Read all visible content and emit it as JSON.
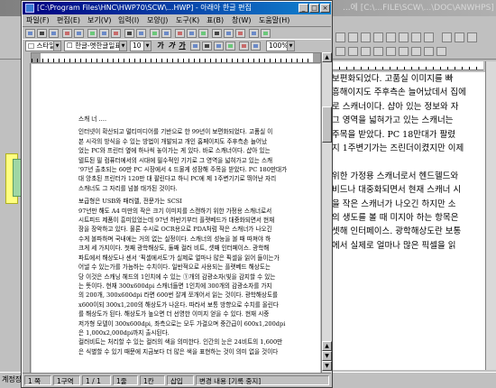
{
  "background_window": {
    "title": "...에 [C:\\...FILE\\SCW\\...\\DOC\\ANWHPS] 문서",
    "document_lines": [
      "보편화되었다. 고품실 이미지를 빠",
      "흥해이지도 주후측손 늘어났데서 집에",
      "로 스캐너이다. 샵아 있는 정보와 자",
      "그 영역을 넓혀가고 있는 스캐너는",
      "주목을 받았다. PC 18만대가 팔렸",
      "지 1주변기가는 즈린더이켰지만 이제",
      "",
      "위한 가정용 스캐너로서 헨드헬드와",
      "비드나 대중화되면서 현재 스캐너 시",
      "을 작은 스캐너가 나오긴 하지만 소",
      "의 생도를 볼 때 미지아 하는 항목은",
      "셋해 인터페이스. 광학해상도란 보통",
      "에서 실제로 얼마나 많은 픽셀을 읽"
    ],
    "status_text": "계정장"
  },
  "window": {
    "title": "[C:\\Program Files\\HNC\\HWP70\\SCW\\...HWP] - 아래아 한글 편집",
    "menu": [
      "파일(F)",
      "편집(E)",
      "보기(V)",
      "입력(I)",
      "모양(J)",
      "도구(K)",
      "표(B)",
      "창(W)",
      "도움말(H)"
    ],
    "style_combo": "□ 스타일",
    "font_combo": "☐ 한글-옛한글일표",
    "size_combo": "10",
    "zoom": "100%",
    "status": {
      "page": "1 쪽",
      "section": "1구역",
      "line": "1 / 1",
      "position": "1줄",
      "col": "1칸",
      "mode": "삽입",
      "extra": "변경 내용 [기록 중지]"
    }
  },
  "document": {
    "heading": "스캐 너 ‥‥",
    "paragraphs": [
      [
        "인터넷이 확산되고 멀티미디어를 기반으로 한 99년이 보편화되었다. 고품실 이",
        "본 시각의 방식을 수 있는 방법이 개발되고 개인 홈페이지도 주후측손 늘어났",
        "었는 PC와 프린터 옆에 하나씩 놓이가는 게 있다. 바로 스캐너이다. 샵아 있는",
        "텔트된 필 컴퓨터에서의 시대에 필수적인 기기로 그 영역을 넓혀가고 있는 스캐",
        "'97년 출초되는 60만 PC 시장에서 4 드물게 성장해 주목을 받았다. PC 180만대가",
        "대 앙초된 프린터가 120만 대 팔린다고 하니 PC에 제 1주변기기로 뛰어난 자리",
        "스캐너도 그 자리를 넘볼 태가된 것이다."
      ],
      [
        "보급형은 USB와 패러렐, 전문가는 SCSI",
        "97년만 해도 A4 미만의 작은 크기 이미지를 스캔하기 위한 가정용 스캐너로서",
        "시트피드 제품이 흥미있었는데 97년 하반기부터 플랫베드가 대중화되면서 현재",
        "장을 장악하고 있다. 물론 수시로 OCR용으로 PDA처럼 작은 스캐너가 나오긴",
        "수게 볼파하며 국내에는 거의 없는 실정이다. 스캐너의 성능을 볼 때 따져야 하",
        "크게 세 가지이다. 첫째 광학해상도, 둘째 컬러 비트, 셋째 인터페이스. 광학해",
        "파트에서 해상도나 센서 '픽셀에서도'가 실제로 얼마나 많은 픽셀을 읽어 들이는가",
        "어낼 수 있는가를 가늠하는 수치이다. 일반적으로 사용되는 플랫베드 해상도는",
        "당 이것은 스캐닝 헤드의 1인치에 수 있는 ①개의 감광소자(빛을 감지할 수 있는",
        "는 뜻이다. 현재 300x600dpi 스캐너들면 1인치에 300개의 감광소자를 가지",
        "의 200개, 300x600dpi 라면 600번 잘게 쪼개어서 읽는 것이다. 광학해상도를",
        "x600이되 300x1,200의 해상도가 나온다. 따라서 보통 방향으로 수치를 올린다",
        "를 해상도가 된다. 해상도가 높으면 더 선명한 이미지 얻을 수 있다. 현재 시중",
        "저가형 모델이 300x600dpi, 좌측으로는 모두 가결으며 중간급이 600x1,200dpi",
        "은 1,000x2,000dpi까지 출시된다.",
        "컬러비트는 처리할 수 있는 컬러의 색을 의미한다. 인간의 눈은 24비트의 1,600만",
        "은 식별할 수 있기 때문에 지금보다 더 많은 색을 표현하는 것이 의미 없을 것이다"
      ]
    ]
  },
  "colors": {
    "titlebar_active": "#000080",
    "titlebar_active_end": "#1084d0",
    "window_face": "#c0c0c0",
    "page": "#ffffff"
  }
}
